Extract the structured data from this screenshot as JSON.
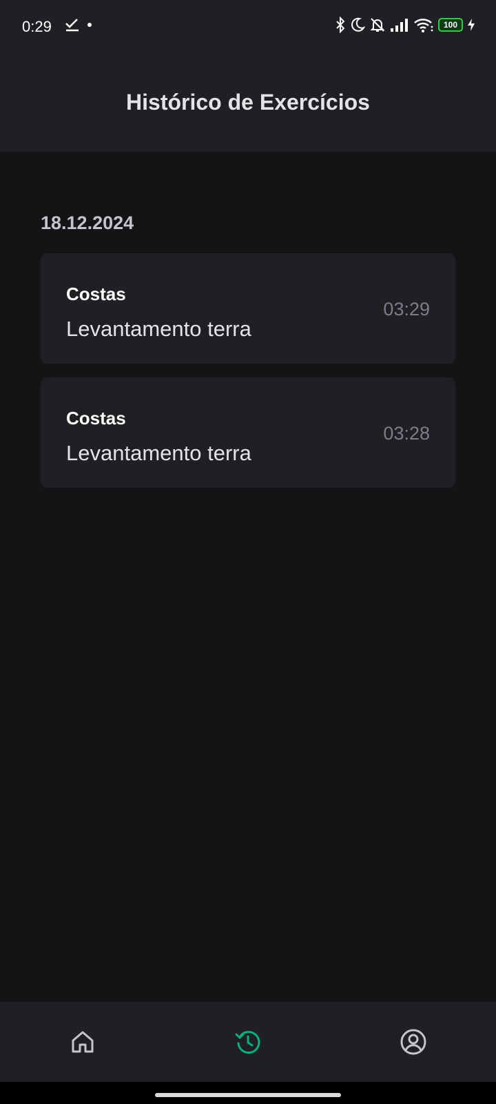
{
  "status_bar": {
    "time": "0:29",
    "battery": "100",
    "icons": [
      "check-download-icon",
      "dot-icon",
      "bluetooth-icon",
      "moon-icon",
      "bell-off-icon",
      "signal-icon",
      "wifi-icon",
      "battery-icon",
      "charging-icon"
    ]
  },
  "header": {
    "title": "Histórico de Exercícios"
  },
  "history": {
    "date": "18.12.2024",
    "items": [
      {
        "group": "Costas",
        "exercise": "Levantamento terra",
        "time": "03:29"
      },
      {
        "group": "Costas",
        "exercise": "Levantamento terra",
        "time": "03:28"
      }
    ]
  },
  "tabbar": {
    "tabs": [
      {
        "icon": "home-icon",
        "active": false
      },
      {
        "icon": "history-icon",
        "active": true
      },
      {
        "icon": "profile-icon",
        "active": false
      }
    ]
  },
  "colors": {
    "background": "#141416",
    "surface": "#202024",
    "accent": "#00b37e",
    "muted": "#7c7c8a"
  }
}
